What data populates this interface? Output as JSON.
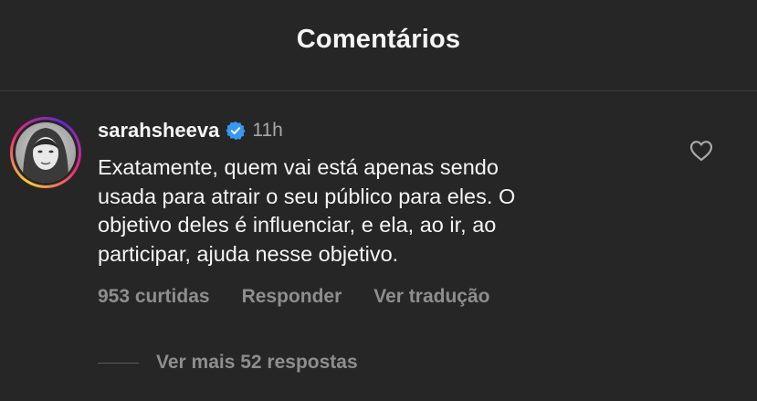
{
  "header": {
    "title": "Comentários"
  },
  "comment": {
    "username": "sarahsheeva",
    "verified_icon": "verified-badge-icon",
    "time": "11h",
    "lines": [
      "Exatamente, quem vai está apenas sendo",
      "usada para atrair o seu público para eles. O",
      "objetivo deles é influenciar, e ela, ao ir, ao",
      "participar, ajuda nesse objetivo."
    ],
    "like_icon": "heart-outline-icon",
    "likes": "953 curtidas",
    "reply_label": "Responder",
    "translate_label": "Ver tradução",
    "view_replies": "Ver mais 52 respostas"
  },
  "colors": {
    "background": "#262626",
    "text": "#f5f5f5",
    "muted": "#8e8e8e",
    "verified": "#3897f0"
  }
}
